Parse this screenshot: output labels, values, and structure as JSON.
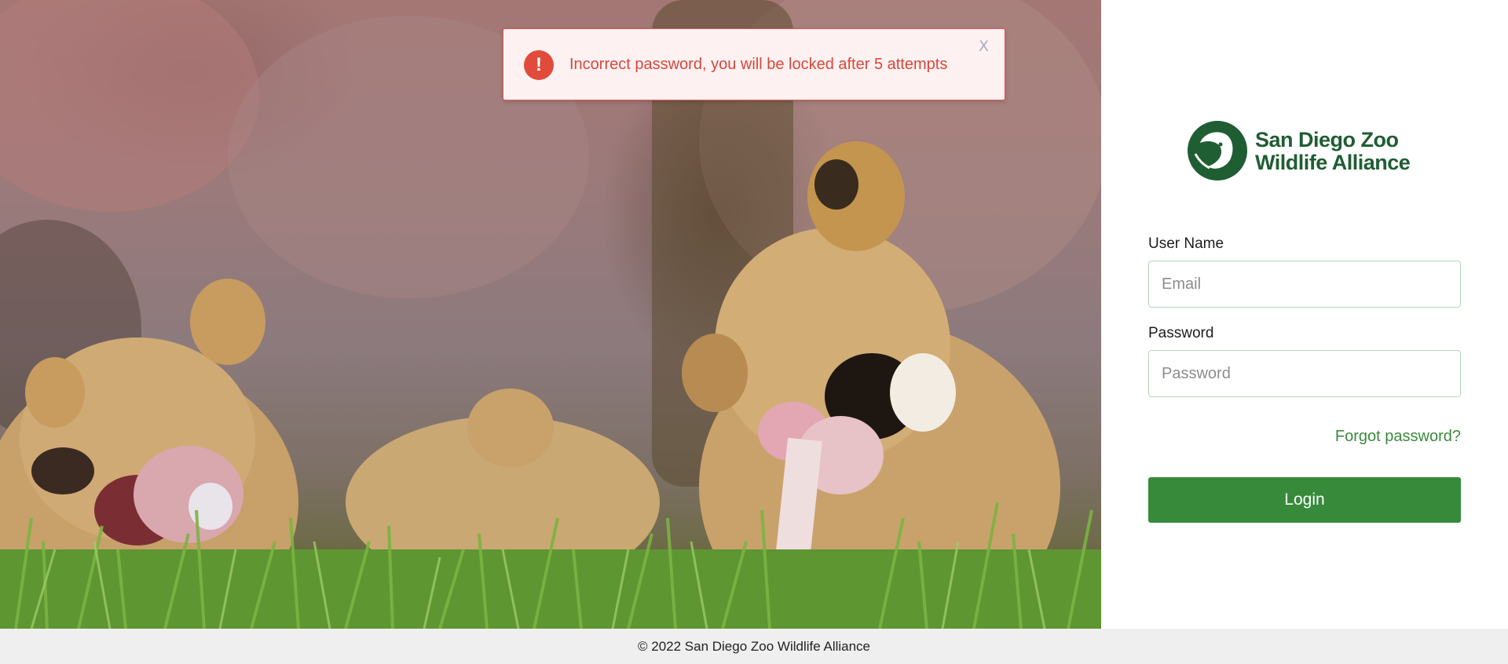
{
  "hero": {
    "image": "lions-eating-photo"
  },
  "alert": {
    "message": "Incorrect password, you will be locked after 5 attempts",
    "icon": "exclamation-icon",
    "icon_glyph": "!",
    "close_label": "X",
    "color": "#d8473a"
  },
  "logo": {
    "line1": "San Diego Zoo",
    "line2": "Wildlife Alliance",
    "icon": "lion-emblem-icon",
    "color": "#1f5d33"
  },
  "form": {
    "username_label": "User Name",
    "username_placeholder": "Email",
    "username_value": "",
    "password_label": "Password",
    "password_placeholder": "Password",
    "password_value": "",
    "forgot_label": "Forgot password?",
    "login_label": "Login",
    "button_color": "#378a3a"
  },
  "footer": {
    "text": "© 2022 San Diego Zoo Wildlife Alliance"
  }
}
